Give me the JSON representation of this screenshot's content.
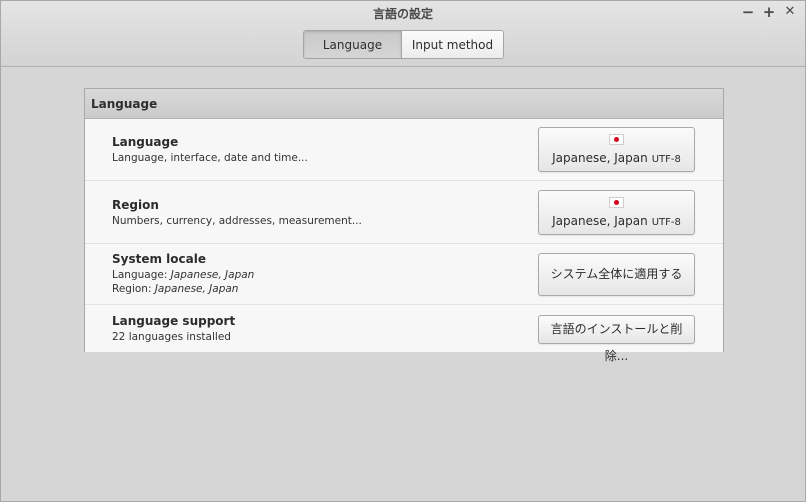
{
  "window": {
    "title": "言語の設定",
    "minimize": "−",
    "maximize": "+",
    "close": "✕"
  },
  "stack": {
    "tabs": [
      {
        "label": "Language",
        "active": true
      },
      {
        "label": "Input method",
        "active": false
      }
    ]
  },
  "panel": {
    "header": "Language",
    "rows": [
      {
        "title": "Language",
        "subtitle": "Language, interface, date and time...",
        "button_flag": "flag-japan-icon",
        "button_label": "Japanese, Japan",
        "button_encoding": "UTF-8"
      },
      {
        "title": "Region",
        "subtitle": "Numbers, currency, addresses, measurement...",
        "button_flag": "flag-japan-icon",
        "button_label": "Japanese, Japan",
        "button_encoding": "UTF-8"
      },
      {
        "title": "System locale",
        "line1_prefix": "Language: ",
        "line1_value": "Japanese, Japan",
        "line2_prefix": "Region: ",
        "line2_value": "Japanese, Japan",
        "button_label": "システム全体に適用する"
      },
      {
        "title": "Language support",
        "subtitle": "22 languages installed",
        "button_label": "言語のインストールと削除..."
      }
    ]
  },
  "colors": {
    "window_bg": "#d6d6d6",
    "panel_bg": "#f7f7f7",
    "flag_red": "#d4001e"
  }
}
